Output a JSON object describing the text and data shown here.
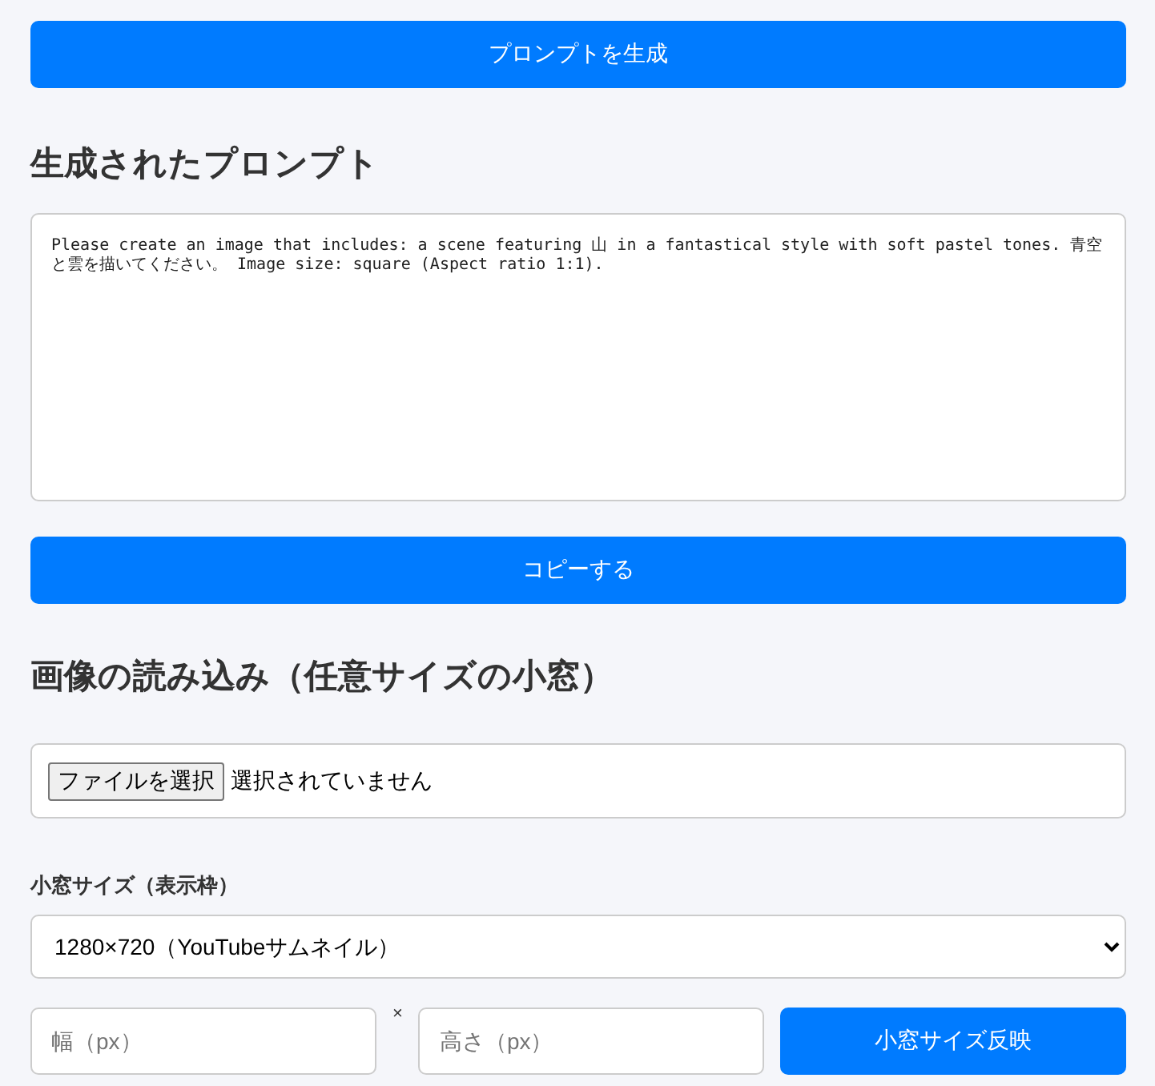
{
  "generate_button": "プロンプトを生成",
  "prompt_heading": "生成されたプロンプト",
  "prompt_text": "Please create an image that includes: a scene featuring 山 in a fantastical style with soft pastel tones. 青空と雲を描いてください。 Image size: square (Aspect ratio 1:1).",
  "copy_button": "コピーする",
  "image_heading": "画像の読み込み（任意サイズの小窓）",
  "file_input": {
    "button": "ファイルを選択",
    "status": "選択されていません"
  },
  "size_label": "小窓サイズ（表示枠）",
  "size_select": {
    "value": "1280×720（YouTubeサムネイル）"
  },
  "width_field": {
    "placeholder": "幅（px）"
  },
  "times_sign": "×",
  "height_field": {
    "placeholder": "高さ（px）"
  },
  "apply_button": "小窓サイズ反映"
}
